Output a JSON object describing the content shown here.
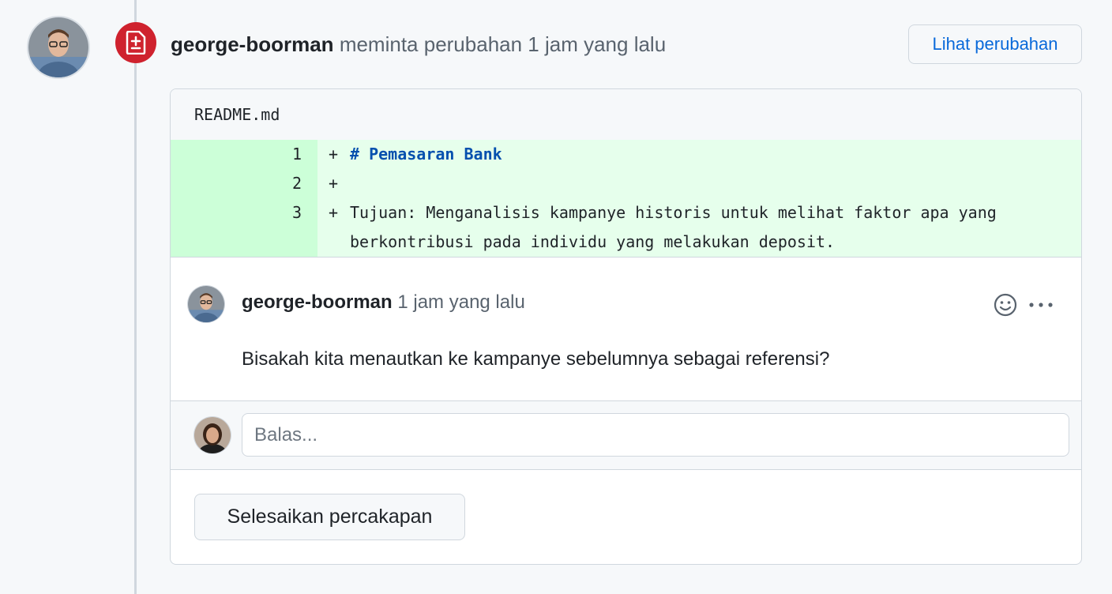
{
  "review": {
    "author": "george-boorman",
    "action": "meminta perubahan 1 jam yang lalu",
    "view_changes_label": "Lihat perubahan"
  },
  "file": {
    "name": "README.md",
    "lines": [
      {
        "number": "1",
        "sign": "+",
        "code": "# Pemasaran Bank",
        "style": "heading"
      },
      {
        "number": "2",
        "sign": "+",
        "code": "",
        "style": "normal"
      },
      {
        "number": "3",
        "sign": "+",
        "code": "Tujuan: Menganalisis kampanye historis untuk melihat faktor apa yang",
        "style": "normal"
      },
      {
        "number": "",
        "sign": "",
        "code": "berkontribusi pada individu yang melakukan deposit.",
        "style": "normal"
      }
    ]
  },
  "comment": {
    "author": "george-boorman",
    "time": "1 jam yang lalu",
    "body": "Bisakah kita menautkan ke kampanye sebelumnya sebagai referensi?"
  },
  "reply": {
    "placeholder": "Balas..."
  },
  "resolve_label": "Selesaikan percakapan",
  "icons": {
    "badge": "file-diff-icon",
    "reaction": "smiley-icon",
    "more": "kebab-horizontal-icon"
  },
  "colors": {
    "badge_red": "#cf222e",
    "link_blue": "#0969da",
    "diff_added_bg": "#e6ffec",
    "diff_added_gutter": "#ccffd8",
    "heading_blue": "#0550ae"
  }
}
